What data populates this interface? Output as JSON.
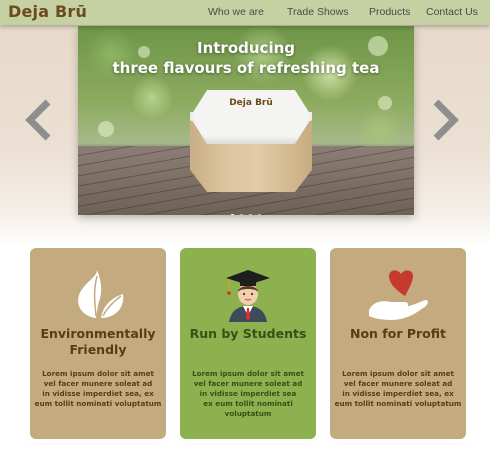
{
  "brand": {
    "name": "Deja Brū"
  },
  "nav": {
    "items": [
      {
        "label": "Who we are"
      },
      {
        "label": "Trade Shows"
      },
      {
        "label": "Products"
      },
      {
        "label": "Contact Us"
      }
    ]
  },
  "slider": {
    "heading_line1": "Introducing",
    "heading_line2": "three flavours of refreshing tea",
    "box_logo": "Deja Brū",
    "prev_icon": "chevron-left-icon",
    "next_icon": "chevron-right-icon",
    "slide_count": 4,
    "active_slide": 1
  },
  "cards": [
    {
      "icon": "leaf-icon",
      "title_line1": "Environmentally",
      "title_line2": "Friendly",
      "text": [
        "Lorem ipsum dolor sit amet",
        "vel facer munere soleat ad",
        "in vidisse imperdiet sea, ex",
        "eum tollit nominati voluptatum"
      ],
      "color": "#c4ab7f"
    },
    {
      "icon": "graduate-icon",
      "title_line1": "Run by Students",
      "text": [
        "Lorem ipsum dolor sit amet",
        "vel facer munere soleat ad",
        "in vidisse imperdiet sea",
        "ex eum tollit nominati",
        "voluptatum"
      ],
      "color": "#8cb14e"
    },
    {
      "icon": "heart-hand-icon",
      "title_line1": "Non for Profit",
      "text": [
        "Lorem ipsum dolor sit amet",
        "vel facer munere soleat ad",
        "in vidisse imperdiet sea, ex",
        "eum tollit nominati voluptatum"
      ],
      "color": "#c4ab7f"
    }
  ],
  "colors": {
    "nav_bg": "#c5d1a3",
    "brand_brown": "#6b4a1e",
    "tan_card": "#c4ab7f",
    "green_card": "#8cb14e"
  }
}
